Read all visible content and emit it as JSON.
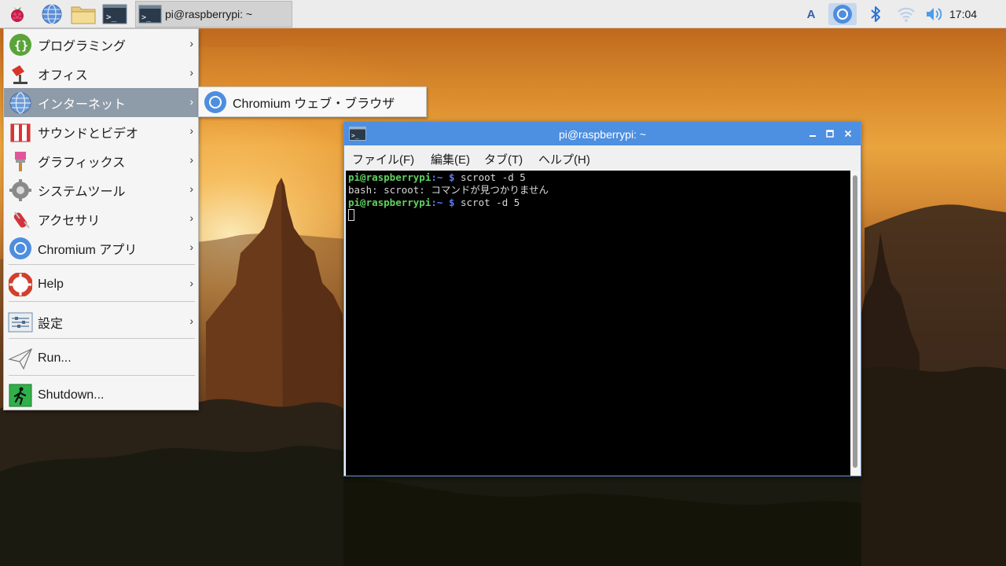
{
  "panel": {
    "launcher_icons": [
      "raspberry-icon",
      "globe-icon",
      "folder-icon",
      "terminal-icon"
    ],
    "task_button_label": "pi@raspberrypi: ~",
    "keyboard_indicator": "A",
    "clock": "17:04"
  },
  "menu": {
    "items": [
      {
        "label": "プログラミング",
        "icon": "programming-icon"
      },
      {
        "label": "オフィス",
        "icon": "office-icon"
      },
      {
        "label": "インターネット",
        "icon": "internet-icon"
      },
      {
        "label": "サウンドとビデオ",
        "icon": "sound-video-icon"
      },
      {
        "label": "グラフィックス",
        "icon": "graphics-icon"
      },
      {
        "label": "システムツール",
        "icon": "system-tools-icon"
      },
      {
        "label": "アクセサリ",
        "icon": "accessories-icon"
      },
      {
        "label": "Chromium アプリ",
        "icon": "chromium-icon"
      },
      {
        "label": "Help",
        "icon": "help-icon"
      },
      {
        "label": "設定",
        "icon": "settings-icon"
      },
      {
        "label": "Run...",
        "icon": "run-icon"
      },
      {
        "label": "Shutdown...",
        "icon": "shutdown-icon"
      }
    ],
    "active_item": "インターネット",
    "submenu": {
      "label": "Chromium ウェブ・ブラウザ",
      "icon": "chromium-icon"
    }
  },
  "terminal": {
    "title": "pi@raspberrypi: ~",
    "menubar": [
      "ファイル(F)",
      "編集(E)",
      "タブ(T)",
      "ヘルプ(H)"
    ],
    "lines": [
      {
        "user": "pi@raspberrypi",
        "path": ":~",
        "prompt": " $",
        "cmd": " scroot -d 5"
      },
      {
        "text": "bash: scroot: コマンドが見つかりません"
      },
      {
        "user": "pi@raspberrypi",
        "path": ":~",
        "prompt": " $",
        "cmd": " scrot -d 5"
      }
    ]
  },
  "colors": {
    "panel_bg": "#ececec",
    "titlebar": "#4d8fe0",
    "menu_highlight": "#8e9ba8",
    "prompt_user": "#5fd35f",
    "prompt_path": "#5c7cfa"
  }
}
